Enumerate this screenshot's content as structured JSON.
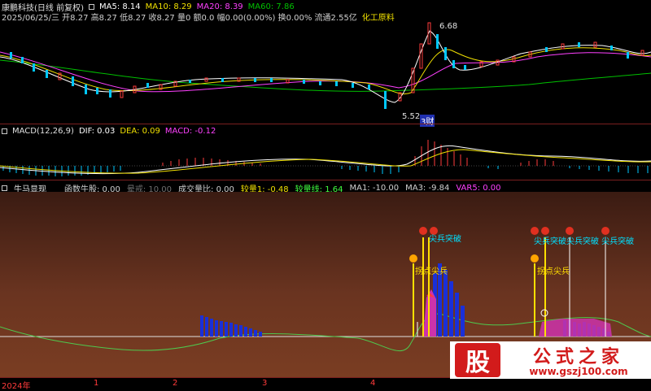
{
  "header": {
    "title": "康鹏科技(日线 前复权)",
    "ma5": "MA5: 8.14",
    "ma10": "MA10: 8.29",
    "ma20": "MA20: 8.39",
    "ma60": "MA60: 7.86",
    "quote": "2025/06/25/三 开8.27 高8.27 低8.27 收8.27 量0 额0.0 幅0.00(0.00%) 换0.00% 流通2.55亿",
    "sector": "化工原料",
    "price_high": "6.68",
    "price_low": "5.52",
    "event": "3财"
  },
  "macd": {
    "title": "MACD(12,26,9)",
    "dif": "DIF: 0.03",
    "dea": "DEA: 0.09",
    "macd": "MACD: -0.12"
  },
  "indicator": {
    "title": "牛马显现",
    "v1": "函数牛股: 0.00",
    "v2": "晕戒: 10.00",
    "v3": "成交量比: 0.00",
    "v4": "较量1: -0.48",
    "v5": "较量线: 1.64",
    "v6": "MA1: -10.00",
    "v7": "MA3: -9.84",
    "v8": "VAR5: 0.00",
    "labels": {
      "breakout": "尖兵突破",
      "pick": "拐点尖兵",
      "flag": "尖兵突破尖兵突破 尖兵突破"
    }
  },
  "xaxis": {
    "year": "2024年",
    "months": [
      "1",
      "2",
      "3",
      "4"
    ]
  },
  "watermark": {
    "logo": "股",
    "name": "公式之家",
    "url": "www.gszj100.com"
  },
  "colors": {
    "bg": "#000000",
    "up": "#ff3b3b",
    "down": "#00c8ff",
    "ma5": "#ffffff",
    "ma10": "#f0e000",
    "ma20": "#ff40ff",
    "ma60": "#00c000",
    "bar": "#1a2fd8",
    "yellow": "#ffe000",
    "magenta": "#cc33aa"
  }
}
